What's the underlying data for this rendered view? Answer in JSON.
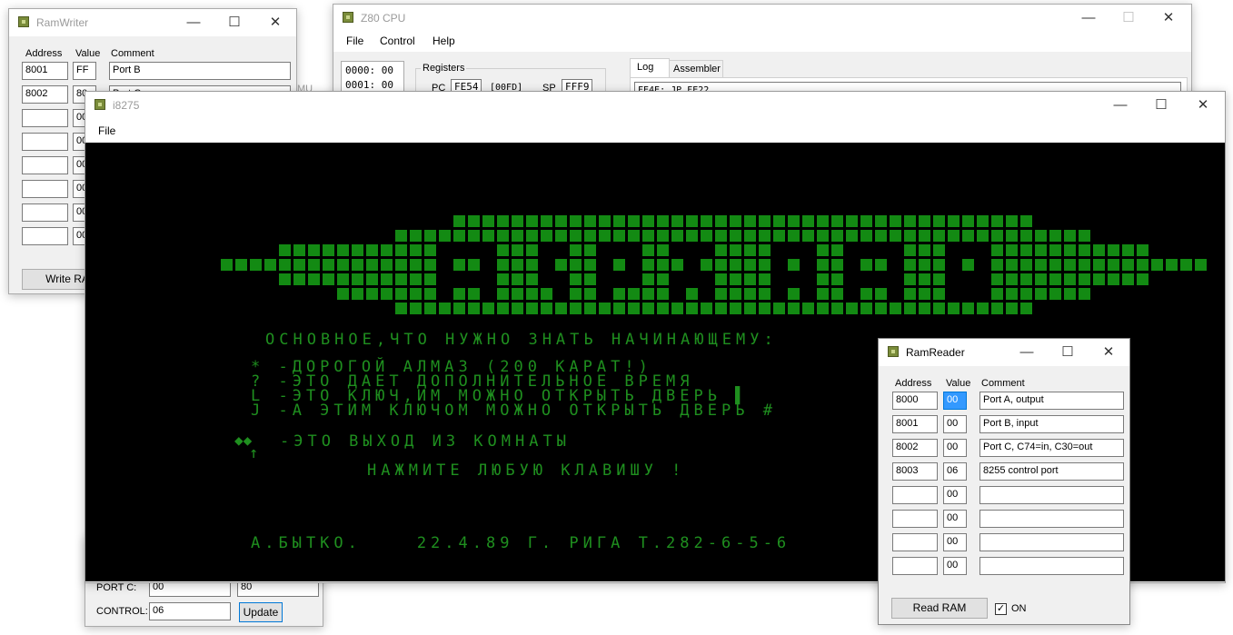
{
  "ram_writer": {
    "title": "RamWriter",
    "headers": {
      "address": "Address",
      "value": "Value",
      "comment": "Comment"
    },
    "rows": [
      {
        "address": "8001",
        "value": "FF",
        "comment": "Port B"
      },
      {
        "address": "8002",
        "value": "80",
        "comment": "Port C"
      },
      {
        "address": "",
        "value": "00",
        "comment": ""
      },
      {
        "address": "",
        "value": "00",
        "comment": ""
      },
      {
        "address": "",
        "value": "00",
        "comment": ""
      },
      {
        "address": "",
        "value": "00",
        "comment": ""
      },
      {
        "address": "",
        "value": "00",
        "comment": ""
      },
      {
        "address": "",
        "value": "00",
        "comment": ""
      }
    ],
    "write_button": "Write RAM",
    "behind_text": "MU"
  },
  "z80": {
    "title": "Z80 CPU",
    "menu": [
      "File",
      "Control",
      "Help"
    ],
    "memory_lines": [
      "0000: 00",
      "0001: 00"
    ],
    "registers_label": "Registers",
    "pc_label": "PC",
    "pc_value": "FE54",
    "pc_mem": "[00FD]",
    "sp_label": "SP",
    "sp_value": "FFF9",
    "tabs": [
      "Log",
      "Assembler"
    ],
    "log_line": "FE4E: JP FE22"
  },
  "i8275": {
    "title": "i8275",
    "menu": [
      "File"
    ],
    "screen_lines": {
      "heading": "ОСНОВНОЕ,ЧТО НУЖНО ЗНАТЬ НАЧИНАЮЩЕМУ:",
      "legend": [
        "* -ДОРОГОЙ АЛМАЗ (200 КАРАТ!)",
        "? -ЭТО ДАЕТ ДОПОЛНИТЕЛЬНОЕ ВРЕМЯ",
        "L -ЭТО КЛЮЧ,ИМ МОЖНО ОТКРЫТЬ ДВЕРЬ ▌",
        "J -А ЭТИМ КЛЮЧОМ МОЖНО ОТКРЫТЬ ДВЕРЬ #"
      ],
      "exit_arrows": "◆◆",
      "exit_up": "↑",
      "exit_line": "-ЭТО ВЫХОД ИЗ КОМНАТЫ",
      "press_key": "НАЖМИТЕ ЛЮБУЮ КЛАВИШУ !",
      "footer": "А.БЫТКО.    22.4.89 Г. РИГА Т.282-6-5-6"
    },
    "screen_color": "#1f8f1f"
  },
  "ppi": {
    "port_c_label": "PORT C:",
    "port_c_value": "00",
    "port_c_value2": "80",
    "control_label": "CONTROL:",
    "control_value": "06",
    "update_button": "Update"
  },
  "ram_reader": {
    "title": "RamReader",
    "headers": {
      "address": "Address",
      "value": "Value",
      "comment": "Comment"
    },
    "rows": [
      {
        "address": "8000",
        "value": "00",
        "comment": "Port A, output"
      },
      {
        "address": "8001",
        "value": "00",
        "comment": "Port B, input"
      },
      {
        "address": "8002",
        "value": "00",
        "comment": "Port C, C74=in, C30=out"
      },
      {
        "address": "8003",
        "value": "06",
        "comment": "8255 control port"
      },
      {
        "address": "",
        "value": "00",
        "comment": ""
      },
      {
        "address": "",
        "value": "00",
        "comment": ""
      },
      {
        "address": "",
        "value": "00",
        "comment": ""
      },
      {
        "address": "",
        "value": "00",
        "comment": ""
      }
    ],
    "read_button": "Read RAM",
    "on_label": "ON",
    "on_checked": true
  }
}
